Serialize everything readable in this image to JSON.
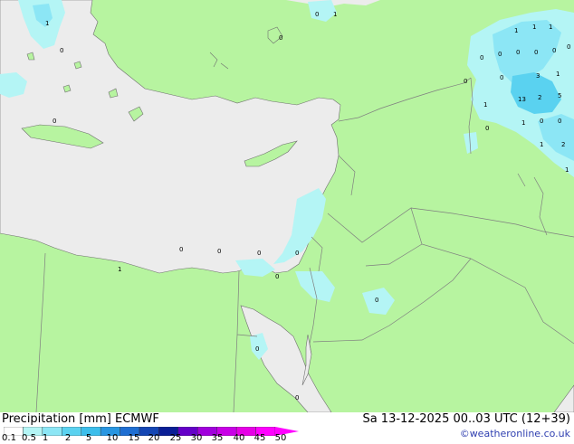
{
  "title": "Precipitation [mm]  ECMWF",
  "datetime": "Sa 13-12-2025 00..03 UTC (12+39)",
  "credit": "©weatheronline.co.uk",
  "legend": {
    "ticks": [
      "0.1",
      "0.5",
      "1",
      "2",
      "5",
      "10",
      "15",
      "20",
      "25",
      "30",
      "35",
      "40",
      "45",
      "50"
    ],
    "colors": [
      "#ffffff",
      "#b4f5f5",
      "#8ce6f5",
      "#5ad2f0",
      "#3cbeeb",
      "#2896e1",
      "#1e6ed2",
      "#1446b4",
      "#0a1e96",
      "#6400c8",
      "#a000dc",
      "#c800e6",
      "#e600e6",
      "#ff00ff"
    ]
  },
  "map_labels": [
    "1",
    "0",
    "1",
    "0",
    "1",
    "1",
    "1",
    "0",
    "0",
    "0",
    "0",
    "0",
    "0",
    "0",
    "0",
    "3",
    "1",
    "0",
    "13",
    "2",
    "5",
    "1",
    "1",
    "0",
    "0",
    "2",
    "1",
    "0",
    "1",
    "0",
    "0",
    "0",
    "0",
    "1",
    "0",
    "0",
    "0",
    "0",
    "0"
  ],
  "colors": {
    "land": "#b7f4a0",
    "sea": "#ececec",
    "light_precip": "#b4f5f5",
    "medium_precip": "#8ce6f5",
    "heavy_precip": "#5ad2f0",
    "border": "#7f7f7f"
  }
}
